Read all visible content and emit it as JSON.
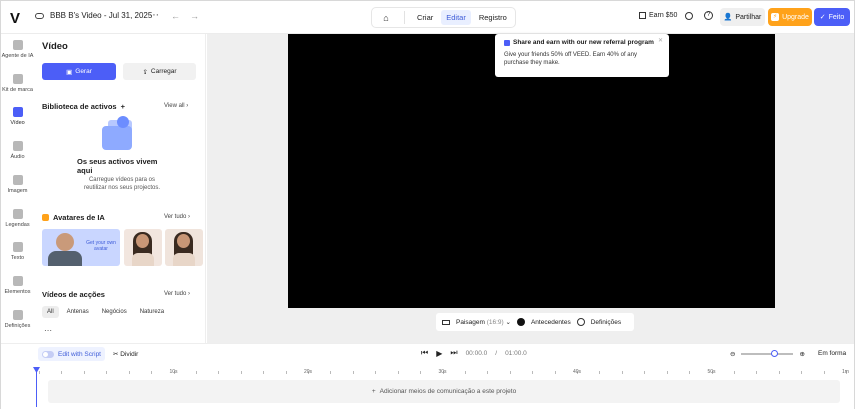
{
  "topbar": {
    "project_title": "BBB B's Video - Jul 31, 2025",
    "tabs": [
      "Criar",
      "Editar",
      "Registro"
    ],
    "active_tab": "Editar",
    "earn_label": "Earn $50",
    "share_label": "Partilhar",
    "upgrade_label": "Upgrade",
    "done_label": "Feito"
  },
  "rail": {
    "items": [
      {
        "label": "Agente de IA",
        "icon": "ai-agent-icon"
      },
      {
        "label": "Kit de marca",
        "icon": "brand-kit-icon"
      },
      {
        "label": "Vídeo",
        "icon": "video-icon",
        "active": true
      },
      {
        "label": "Áudio",
        "icon": "audio-icon"
      },
      {
        "label": "Imagem",
        "icon": "image-icon"
      },
      {
        "label": "Legendas",
        "icon": "subtitles-icon"
      },
      {
        "label": "Texto",
        "icon": "text-icon"
      },
      {
        "label": "Elementos",
        "icon": "elements-icon"
      },
      {
        "label": "Definições",
        "icon": "settings-icon"
      }
    ]
  },
  "panel": {
    "title": "Vídeo",
    "generate_label": "Gerar",
    "upload_label": "Carregar",
    "library": {
      "heading": "Biblioteca de activos",
      "link": "View all",
      "empty_title": "Os seus activos vivem aqui",
      "empty_sub": "Carregue vídeos para os reutilizar nos seus projectos."
    },
    "avatars": {
      "heading": "Avatares de IA",
      "link": "Ver tudo",
      "card_text": "Get your own avatar"
    },
    "stock": {
      "heading": "Vídeos de acções",
      "link": "Ver tudo",
      "chips": [
        "All",
        "Antenas",
        "Negócios",
        "Natureza"
      ]
    }
  },
  "popup": {
    "title": "Share and earn with our new referral program",
    "body": "Give your friends 50% off VEED. Earn 40% of any purchase they make."
  },
  "controls": {
    "aspect_label": "Paisagem",
    "aspect_ratio": "(16:9)",
    "background_label": "Antecedentes",
    "settings_label": "Definições"
  },
  "timeline": {
    "edit_script_label": "Edit with Script",
    "divide_label": "Dividir",
    "current_time": "00:00.0",
    "separator": "/",
    "total_time": "01:00.0",
    "fit_label": "Em forma",
    "zoom_level": 0.63,
    "ruler_labels": [
      "10s",
      "20s",
      "30s",
      "40s",
      "50s",
      "1m"
    ],
    "add_media_label": "Adicionar meios de comunicação a este projeto"
  },
  "colors": {
    "accent": "#4c5ef7",
    "upgrade": "#ffa21a",
    "stage_bg": "#efefef",
    "video_bg": "#000000"
  }
}
